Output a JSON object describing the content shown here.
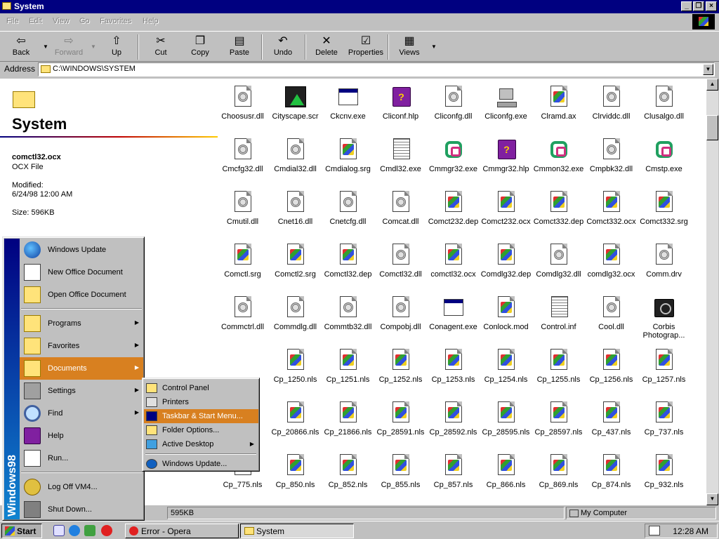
{
  "window": {
    "title": "System",
    "controls": [
      "_",
      "❐",
      "×"
    ]
  },
  "menu": [
    "File",
    "Edit",
    "View",
    "Go",
    "Favorites",
    "Help"
  ],
  "toolbar": {
    "back": "Back",
    "forward": "Forward",
    "up": "Up",
    "cut": "Cut",
    "copy": "Copy",
    "paste": "Paste",
    "undo": "Undo",
    "delete": "Delete",
    "properties": "Properties",
    "views": "Views"
  },
  "address": {
    "label": "Address",
    "value": "C:\\WINDOWS\\SYSTEM"
  },
  "panel": {
    "title": "System",
    "selected_name": "comctl32.ocx",
    "selected_type": "OCX File",
    "modified_label": "Modified:",
    "modified_value": "6/24/98 12:00 AM",
    "size": "Size: 596KB"
  },
  "files": [
    [
      "Choosusr.dll",
      "Cityscape.scr",
      "Ckcnv.exe",
      "Cliconf.hlp",
      "Cliconfg.dll",
      "Cliconfg.exe",
      "Clramd.ax",
      "Clrviddc.dll",
      "Clusalgo.dll"
    ],
    [
      "Cmcfg32.dll",
      "Cmdial32.dll",
      "Cmdialog.srg",
      "Cmdl32.exe",
      "Cmmgr32.exe",
      "Cmmgr32.hlp",
      "Cmmon32.exe",
      "Cmpbk32.dll",
      "Cmstp.exe"
    ],
    [
      "Cmutil.dll",
      "Cnet16.dll",
      "Cnetcfg.dll",
      "Comcat.dll",
      "Comct232.dep",
      "Comct232.ocx",
      "Comct332.dep",
      "Comct332.ocx",
      "Comct332.srg"
    ],
    [
      "Comctl.srg",
      "Comctl2.srg",
      "Comctl32.dep",
      "Comctl32.dll",
      "comctl32.ocx",
      "Comdlg32.dep",
      "Comdlg32.dll",
      "comdlg32.ocx",
      "Comm.drv"
    ],
    [
      "Commctrl.dll",
      "Commdlg.dll",
      "Commtb32.dll",
      "Compobj.dll",
      "Conagent.exe",
      "Conlock.mod",
      "Control.inf",
      "Cool.dll",
      "Corbis Photograp..."
    ],
    [
      "",
      "Cp_1250.nls",
      "Cp_1251.nls",
      "Cp_1252.nls",
      "Cp_1253.nls",
      "Cp_1254.nls",
      "Cp_1255.nls",
      "Cp_1256.nls",
      "Cp_1257.nls"
    ],
    [
      "",
      "Cp_20866.nls",
      "Cp_21866.nls",
      "Cp_28591.nls",
      "Cp_28592.nls",
      "Cp_28595.nls",
      "Cp_28597.nls",
      "Cp_437.nls",
      "Cp_737.nls"
    ],
    [
      "Cp_775.nls",
      "Cp_850.nls",
      "Cp_852.nls",
      "Cp_855.nls",
      "Cp_857.nls",
      "Cp_866.nls",
      "Cp_869.nls",
      "Cp_874.nls",
      "Cp_932.nls"
    ]
  ],
  "file_icons": [
    [
      "gear",
      "city",
      "win",
      "book",
      "gear",
      "pc",
      "flag",
      "gear",
      "gear"
    ],
    [
      "gear",
      "gear",
      "flag",
      "txt",
      "knot",
      "book",
      "knot",
      "gear",
      "knot"
    ],
    [
      "gear",
      "gear",
      "gear",
      "gear",
      "flag",
      "flag",
      "flag",
      "flag",
      "flag"
    ],
    [
      "flag",
      "flag",
      "flag",
      "gear",
      "flag",
      "flag",
      "gear",
      "flag",
      "gear"
    ],
    [
      "gear",
      "gear",
      "gear",
      "gear",
      "win",
      "flag",
      "txt",
      "gear",
      "cam"
    ],
    [
      "gear",
      "flag",
      "flag",
      "flag",
      "flag",
      "flag",
      "flag",
      "flag",
      "flag"
    ],
    [
      "flag",
      "flag",
      "flag",
      "flag",
      "flag",
      "flag",
      "flag",
      "flag",
      "flag"
    ],
    [
      "flag",
      "flag",
      "flag",
      "flag",
      "flag",
      "flag",
      "flag",
      "flag",
      "flag"
    ]
  ],
  "start_menu": {
    "banner": "Windows98",
    "items": {
      "windows_update": "Windows Update",
      "new_office": "New Office Document",
      "open_office": "Open Office Document",
      "programs": "Programs",
      "favorites": "Favorites",
      "documents": "Documents",
      "settings": "Settings",
      "find": "Find",
      "help": "Help",
      "run": "Run...",
      "logoff": "Log Off VM4...",
      "shutdown": "Shut Down..."
    }
  },
  "settings_submenu": {
    "control_panel": "Control Panel",
    "printers": "Printers",
    "taskbar": "Taskbar & Start Menu...",
    "folder_options": "Folder Options...",
    "active_desktop": "Active Desktop",
    "windows_update": "Windows Update..."
  },
  "status": {
    "size": "595KB",
    "zone": "My Computer"
  },
  "taskbar": {
    "start": "Start",
    "tasks": [
      "Error - Opera",
      "System"
    ],
    "clock": "12:28 AM"
  },
  "colors": {
    "title_bar": "#000080",
    "highlight": "#d88020",
    "face": "#c0c0c0"
  }
}
